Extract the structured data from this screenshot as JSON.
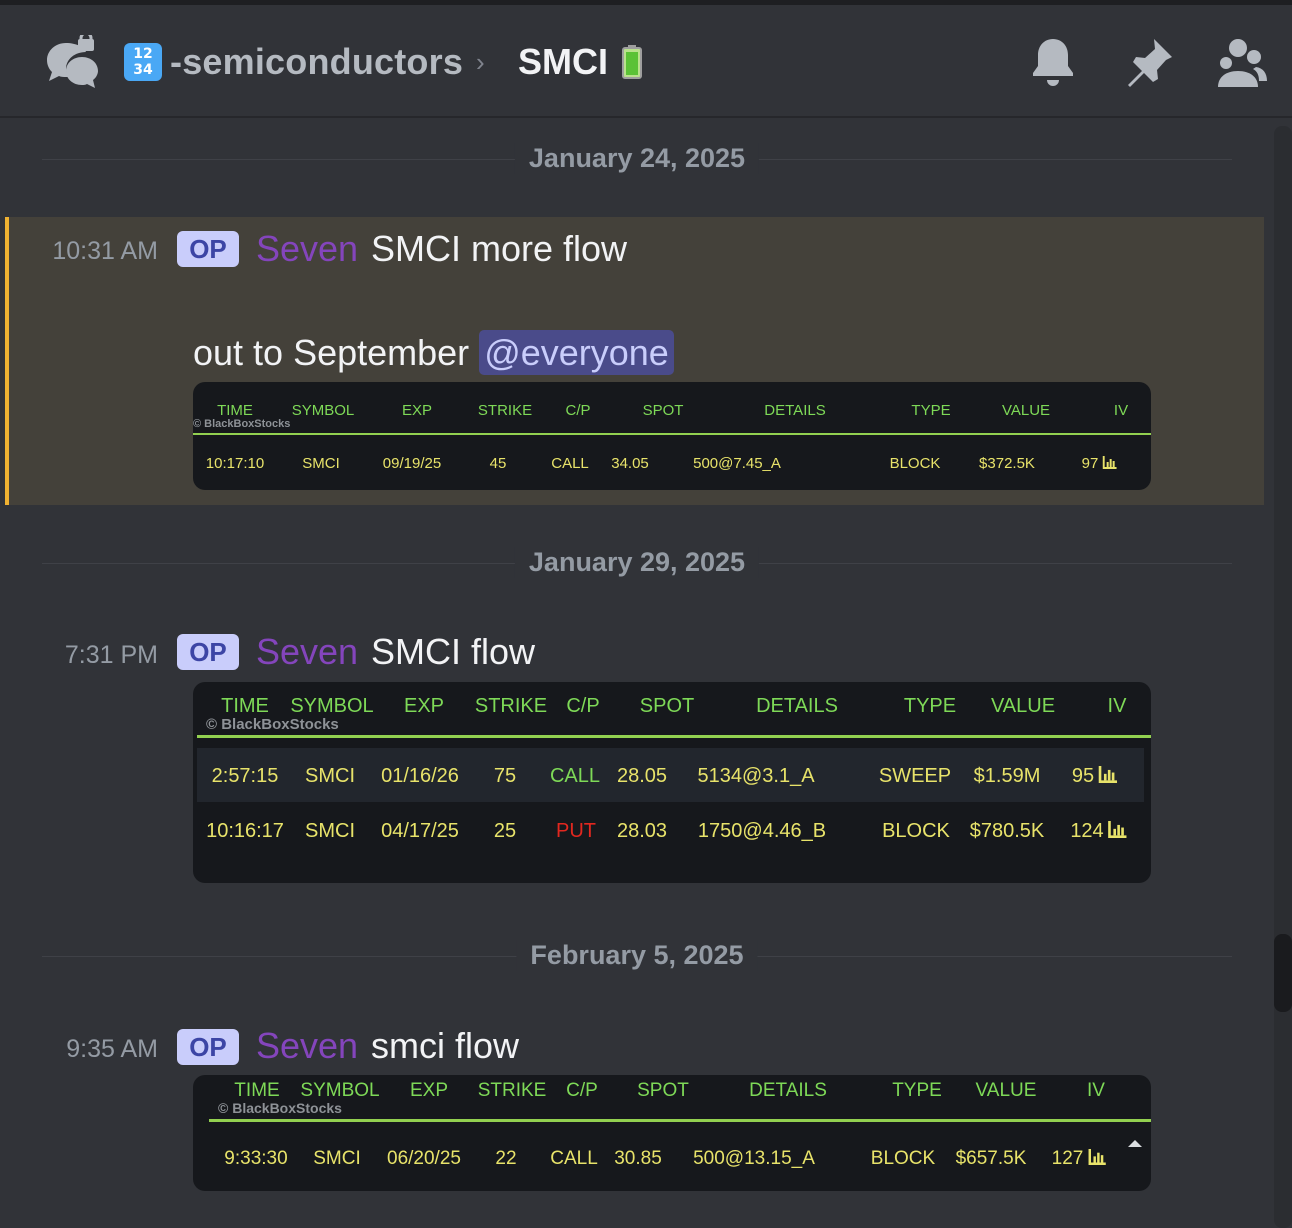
{
  "header": {
    "channel_emoji": "1234",
    "channel_name": "-semiconductors",
    "separator": "›",
    "thread_name": "SMCI"
  },
  "watermark": "© BlackBoxStocks",
  "table_columns": [
    "TIME",
    "SYMBOL",
    "EXP",
    "STRIKE",
    "C/P",
    "SPOT",
    "DETAILS",
    "TYPE",
    "VALUE",
    "IV"
  ],
  "messages": [
    {
      "date": "January 24, 2025",
      "time": "10:31 AM",
      "badge": "OP",
      "author": "Seven",
      "text": "SMCI more flow",
      "text2": "out to September",
      "mention": "@everyone",
      "highlighted": true,
      "rows": [
        {
          "time": "10:17:10",
          "symbol": "SMCI",
          "exp": "09/19/25",
          "strike": "45",
          "cp": "CALL",
          "spot": "34.05",
          "details": "500@7.45_A",
          "type": "BLOCK",
          "value": "$372.5K",
          "iv": "97"
        }
      ]
    },
    {
      "date": "January 29, 2025",
      "time": "7:31 PM",
      "badge": "OP",
      "author": "Seven",
      "text": "SMCI flow",
      "rows": [
        {
          "time": "2:57:15",
          "symbol": "SMCI",
          "exp": "01/16/26",
          "strike": "75",
          "cp": "CALL",
          "spot": "28.05",
          "details": "5134@3.1_A",
          "type": "SWEEP",
          "value": "$1.59M",
          "iv": "95"
        },
        {
          "time": "10:16:17",
          "symbol": "SMCI",
          "exp": "04/17/25",
          "strike": "25",
          "cp": "PUT",
          "spot": "28.03",
          "details": "1750@4.46_B",
          "type": "BLOCK",
          "value": "$780.5K",
          "iv": "124"
        }
      ]
    },
    {
      "date": "February 5, 2025",
      "time": "9:35 AM",
      "badge": "OP",
      "author": "Seven",
      "text": "smci flow",
      "rows": [
        {
          "time": "9:33:30",
          "symbol": "SMCI",
          "exp": "06/20/25",
          "strike": "22",
          "cp": "CALL",
          "spot": "30.85",
          "details": "500@13.15_A",
          "type": "BLOCK",
          "value": "$657.5K",
          "iv": "127"
        }
      ]
    }
  ],
  "icons": [
    "threads-icon",
    "notification-bell-icon",
    "pin-icon",
    "members-icon",
    "battery-icon",
    "chart-icon"
  ],
  "colors": {
    "background": "#313338",
    "highlight": "#44413a",
    "highlight_bar": "#f0b232",
    "author": "#8445bc",
    "op_badge": "#c9cdfb",
    "table_header": "#7ed957",
    "table_value": "#e8e36a",
    "put": "#e2271f"
  }
}
